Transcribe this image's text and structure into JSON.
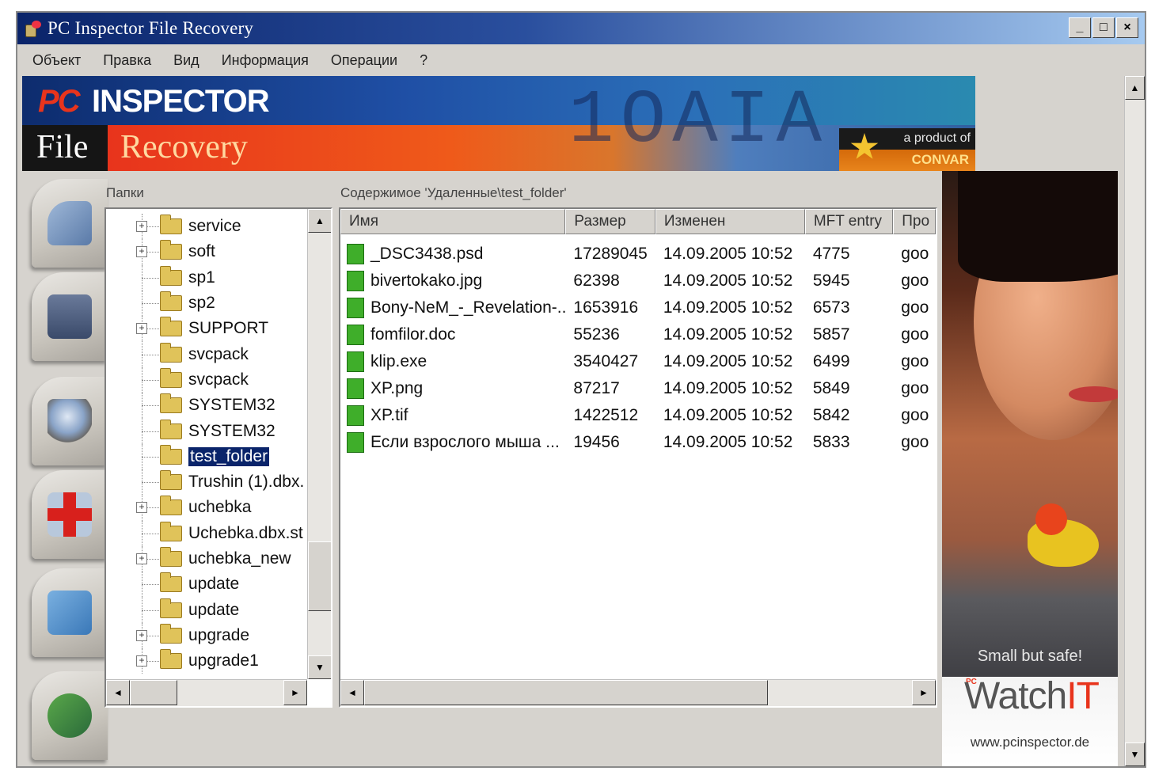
{
  "window": {
    "title": "PC Inspector File Recovery",
    "controls": [
      "_",
      "□",
      "×"
    ]
  },
  "menu": [
    "Объект",
    "Правка",
    "Вид",
    "Информация",
    "Операции",
    "?"
  ],
  "banner": {
    "brand_pc": "PC",
    "brand_inspector": "INSPECTOR",
    "file": "File",
    "recovery": "Recovery",
    "product_of": "a product of",
    "company": "CONVAR"
  },
  "sidebar": {
    "icons": [
      "drive-search-icon",
      "floppy-disk-icon",
      "magnifier-icon",
      "medical-cross-icon",
      "folder-window-icon",
      "help-icon"
    ]
  },
  "folders": {
    "label": "Папки",
    "items": [
      {
        "name": "service",
        "expand": "+",
        "selected": false
      },
      {
        "name": "soft",
        "expand": "+",
        "selected": false
      },
      {
        "name": "sp1",
        "expand": "",
        "selected": false
      },
      {
        "name": "sp2",
        "expand": "",
        "selected": false
      },
      {
        "name": "SUPPORT",
        "expand": "+",
        "selected": false
      },
      {
        "name": "svcpack",
        "expand": "",
        "selected": false
      },
      {
        "name": "svcpack",
        "expand": "",
        "selected": false
      },
      {
        "name": "SYSTEM32",
        "expand": "",
        "selected": false
      },
      {
        "name": "SYSTEM32",
        "expand": "",
        "selected": false
      },
      {
        "name": "test_folder",
        "expand": "",
        "selected": true
      },
      {
        "name": "Trushin (1).dbx.",
        "expand": "",
        "selected": false
      },
      {
        "name": "uchebka",
        "expand": "+",
        "selected": false
      },
      {
        "name": "Uchebka.dbx.st",
        "expand": "",
        "selected": false
      },
      {
        "name": "uchebka_new",
        "expand": "+",
        "selected": false
      },
      {
        "name": "update",
        "expand": "",
        "selected": false
      },
      {
        "name": "update",
        "expand": "",
        "selected": false
      },
      {
        "name": "upgrade",
        "expand": "+",
        "selected": false
      },
      {
        "name": "upgrade1",
        "expand": "+",
        "selected": false
      }
    ]
  },
  "contents": {
    "label": "Содержимое 'Удаленные\\test_folder'",
    "columns": [
      "Имя",
      "Размер",
      "Изменен",
      "MFT entry",
      "Про"
    ],
    "rows": [
      {
        "name": "_DSC3438.psd",
        "size": "17289045",
        "modified": "14.09.2005 10:52",
        "mft": "4775",
        "status": "goo"
      },
      {
        "name": "bivertokako.jpg",
        "size": "62398",
        "modified": "14.09.2005 10:52",
        "mft": "5945",
        "status": "goo"
      },
      {
        "name": "Bony-NeM_-_Revelation-...",
        "size": "1653916",
        "modified": "14.09.2005 10:52",
        "mft": "6573",
        "status": "goo"
      },
      {
        "name": "fomfilor.doc",
        "size": "55236",
        "modified": "14.09.2005 10:52",
        "mft": "5857",
        "status": "goo"
      },
      {
        "name": "klip.exe",
        "size": "3540427",
        "modified": "14.09.2005 10:52",
        "mft": "6499",
        "status": "goo"
      },
      {
        "name": "XP.png",
        "size": "87217",
        "modified": "14.09.2005 10:52",
        "mft": "5849",
        "status": "goo"
      },
      {
        "name": "XP.tif",
        "size": "1422512",
        "modified": "14.09.2005 10:52",
        "mft": "5842",
        "status": "goo"
      },
      {
        "name": "Если взрослого мыша ...",
        "size": "19456",
        "modified": "14.09.2005 10:52",
        "mft": "5833",
        "status": "goo"
      }
    ]
  },
  "ad": {
    "slogan": "Small but safe!",
    "pc": "PC",
    "brand_watch": "Watch",
    "brand_it": "IT",
    "url": "www.pcinspector.de"
  },
  "scroll": {
    "up": "▲",
    "down": "▼",
    "left": "◄",
    "right": "►"
  }
}
